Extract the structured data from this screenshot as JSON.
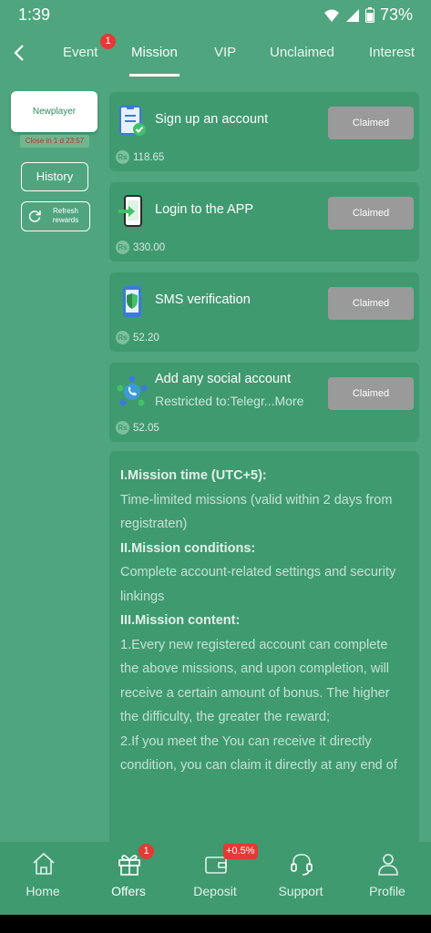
{
  "status": {
    "time": "1:39",
    "battery": "73%"
  },
  "tabs": [
    {
      "label": "Event",
      "badge": "1"
    },
    {
      "label": "Mission",
      "active": true
    },
    {
      "label": "VIP"
    },
    {
      "label": "Unclaimed"
    },
    {
      "label": "Interest"
    }
  ],
  "sidebar": {
    "newplayer": "Newplayer",
    "close_in": "Close in 1 d 23:57",
    "history": "History",
    "refresh": "Refresh rewards"
  },
  "missions": [
    {
      "title": "Sign up an account",
      "reward": "118.65",
      "button": "Claimed",
      "icon": "clipboard-check-icon"
    },
    {
      "title": "Login to the APP",
      "reward": "330.00",
      "button": "Claimed",
      "icon": "phone-login-icon"
    },
    {
      "title": "SMS verification",
      "reward": "52.20",
      "button": "Claimed",
      "icon": "phone-shield-icon"
    },
    {
      "title": "Add any social account",
      "subtitle": "Restricted to:Telegr...",
      "more": "More",
      "reward": "52.05",
      "button": "Claimed",
      "icon": "social-network-icon"
    }
  ],
  "reward_currency_symbol": "Rs",
  "rules": {
    "h1": "I.Mission time (UTC+5):",
    "p1": "Time-limited missions (valid within 2 days from registraten)",
    "h2": "II.Mission conditions:",
    "p2": "Complete account-related settings and security linkings",
    "h3": "III.Mission content:",
    "p3": "1.Every new registered account can complete the above missions, and upon completion, will receive a certain amount of bonus. The higher the difficulty, the greater the reward;",
    "p4": "2.If you meet the You can receive it directly condition, you can claim it directly at any end of"
  },
  "nav": [
    {
      "label": "Home",
      "icon": "home-icon"
    },
    {
      "label": "Offers",
      "icon": "gift-icon",
      "badge": "1",
      "active": true
    },
    {
      "label": "Deposit",
      "icon": "wallet-icon",
      "badge": "+0.5%"
    },
    {
      "label": "Support",
      "icon": "headset-icon"
    },
    {
      "label": "Profile",
      "icon": "person-icon"
    }
  ]
}
